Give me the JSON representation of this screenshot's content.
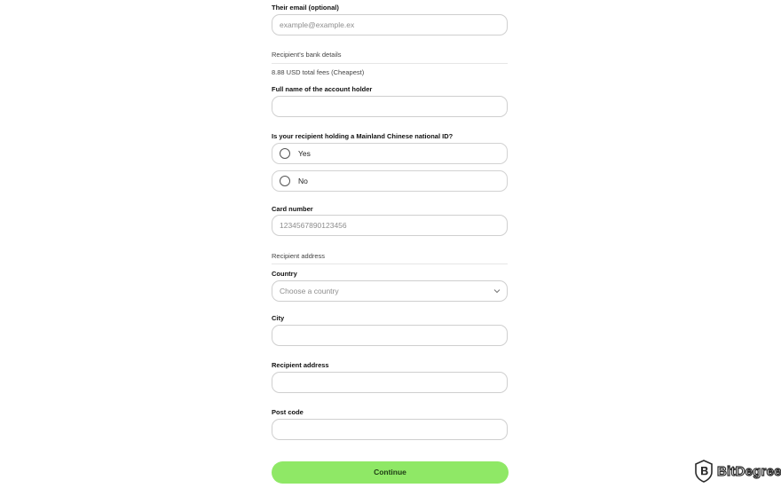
{
  "form": {
    "email": {
      "label": "Their email (optional)",
      "placeholder": "example@example.ex"
    },
    "bank_section_title": "Recipient's bank details",
    "fees_note": "8.88 USD total fees (Cheapest)",
    "holder": {
      "label": "Full name of the account holder",
      "value": ""
    },
    "id_question": {
      "label": "Is your recipient holding a Mainland Chinese national ID?",
      "options": [
        "Yes",
        "No"
      ],
      "selected": null
    },
    "card": {
      "label": "Card number",
      "placeholder": "1234567890123456"
    },
    "address_section_title": "Recipient address",
    "country": {
      "label": "Country",
      "placeholder": "Choose a country"
    },
    "city": {
      "label": "City",
      "value": ""
    },
    "address": {
      "label": "Recipient address",
      "value": ""
    },
    "postcode": {
      "label": "Post code",
      "value": ""
    },
    "submit_label": "Continue"
  },
  "watermark": {
    "text": "BitDegree"
  },
  "colors": {
    "accent": "#8fe866",
    "border": "#cfcfcf"
  },
  "icons": {
    "dropdown": "chevron-down-icon",
    "watermark_logo": "bitdegree-shield-icon"
  }
}
